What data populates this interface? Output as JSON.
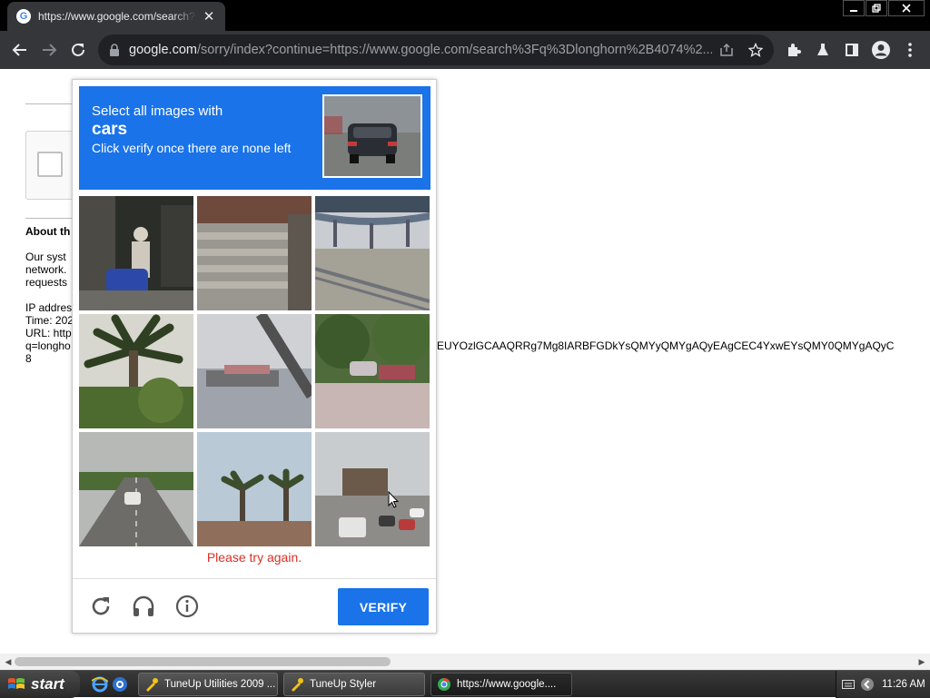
{
  "browser": {
    "tab_title": "https://www.google.com/search?q=",
    "tab_close": "✕",
    "favicon_letter": "G",
    "url_host": "google.com",
    "url_rest": "/sorry/index?continue=https://www.google.com/search%3Fq%3Dlonghorn%2B4074%2...",
    "window_controls": [
      "🗕",
      "🗗",
      "✕"
    ]
  },
  "page": {
    "heading": "About th",
    "body_lines": [
      "Our syst",
      "network.",
      "requests"
    ],
    "meta_lines": [
      "IP addres",
      "Time: 202",
      "URL: http",
      "q=longho",
      "8"
    ],
    "url_overflow": "EUYOzlGCAAQRRg7Mg8IARBFGDkYsQMYyQMYgAQyEAgCEC4YxwEYsQMY0QMYgAQyC"
  },
  "captcha": {
    "instruction_line1": "Select all images with",
    "instruction_object": "cars",
    "instruction_line3": "Click verify once there are none left",
    "error_text": "Please try again.",
    "verify_label": "VERIFY",
    "tiles": [
      "tile-person-scooter",
      "tile-stone-steps",
      "tile-overpass",
      "tile-palm-tree",
      "tile-ship",
      "tile-garden-car",
      "tile-road-car",
      "tile-palms-roof",
      "tile-street-traffic"
    ],
    "accent_color": "#1a73e8",
    "error_color": "#d93025"
  },
  "taskbar": {
    "start_label": "start",
    "tasks": [
      {
        "label": "TuneUp Utilities 2009 ...",
        "active": false
      },
      {
        "label": "TuneUp Styler",
        "active": false
      },
      {
        "label": "https://www.google....",
        "active": true
      }
    ],
    "clock": "11:26 AM"
  }
}
